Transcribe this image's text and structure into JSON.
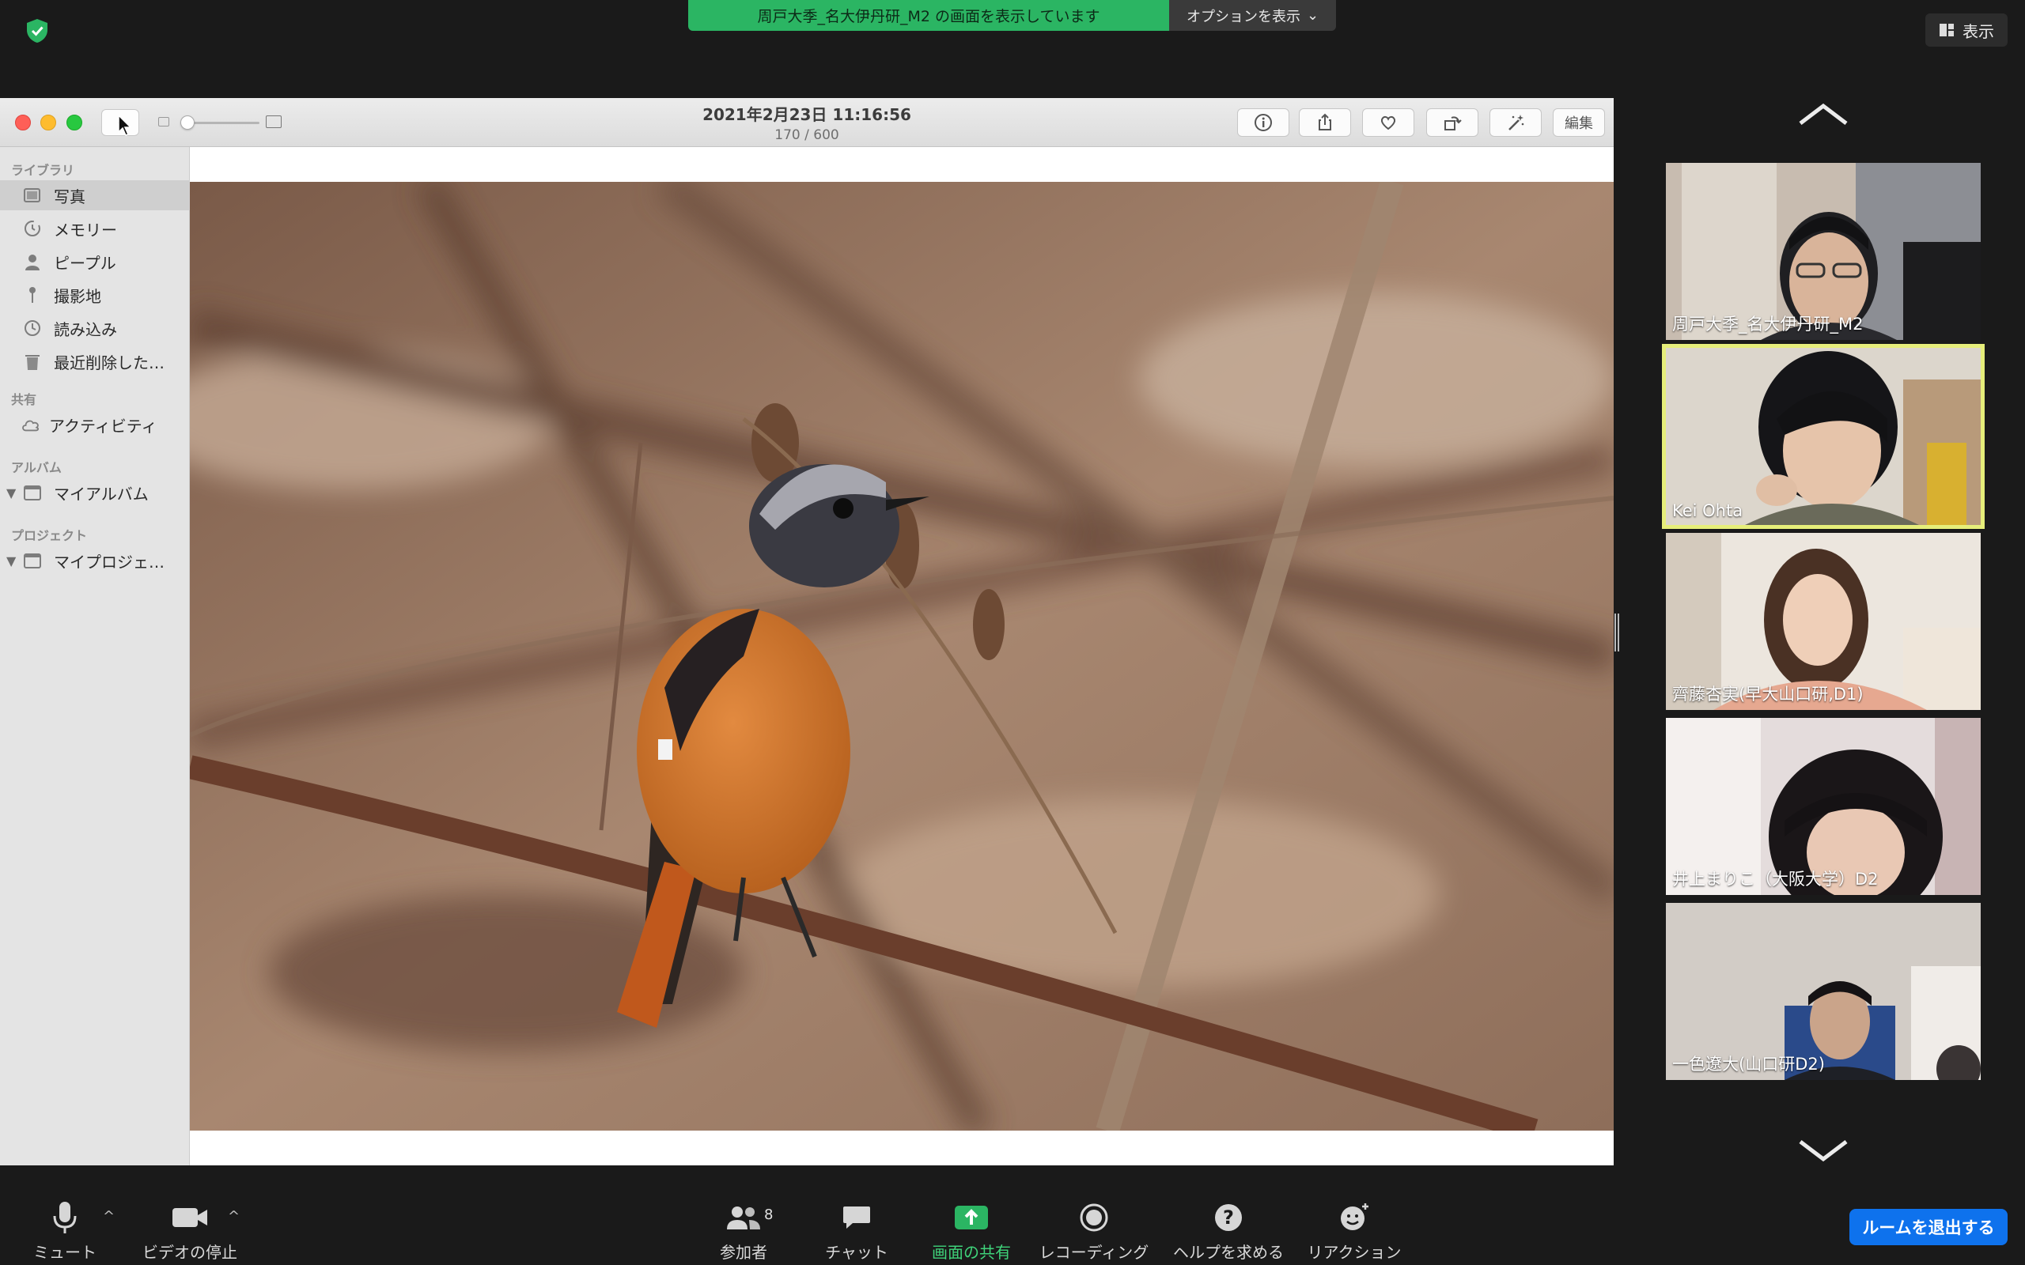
{
  "zoom": {
    "share_banner": "周戸大季_名大伊丹研_M2 の画面を表示しています",
    "view_options": "オプションを表示",
    "view_button": "表示",
    "leave_button": "ルームを退出する",
    "toolbar": {
      "mute": "ミュート",
      "stop_video": "ビデオの停止",
      "participants": "参加者",
      "participants_count": "8",
      "chat": "チャット",
      "share_screen": "画面の共有",
      "recording": "レコーディング",
      "help": "ヘルプを求める",
      "reactions": "リアクション"
    },
    "accent_green": "#2bb563",
    "accent_blue": "#0e72ed"
  },
  "photos": {
    "title_date": "2021年2月23日 11:16:56",
    "title_count": "170 / 600",
    "edit_button": "編集",
    "sidebar": {
      "library_header": "ライブラリ",
      "items": [
        {
          "label": "写真",
          "icon": "photos-icon"
        },
        {
          "label": "メモリー",
          "icon": "memories-icon"
        },
        {
          "label": "ピープル",
          "icon": "people-icon"
        },
        {
          "label": "撮影地",
          "icon": "places-icon"
        },
        {
          "label": "読み込み",
          "icon": "imports-icon"
        },
        {
          "label": "最近削除した…",
          "icon": "trash-icon"
        }
      ],
      "shared_header": "共有",
      "activity": "アクティビティ",
      "albums_header": "アルバム",
      "my_albums": "マイアルバム",
      "projects_header": "プロジェクト",
      "my_projects": "マイプロジェ…"
    }
  },
  "participants": [
    {
      "name": "周戸大季_名大伊丹研_M2"
    },
    {
      "name": "Kei Ohta",
      "active_speaker": true
    },
    {
      "name": "齊藤杏実(早大山口研,D1)"
    },
    {
      "name": "井上まりこ（大阪大学）D2"
    },
    {
      "name": "一色遼大(山口研D2)"
    }
  ]
}
